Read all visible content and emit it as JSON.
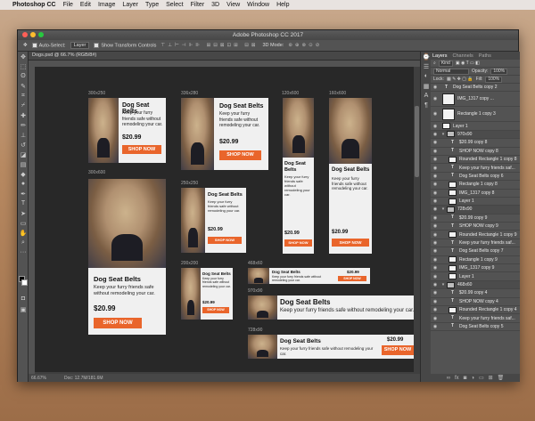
{
  "menubar": {
    "apple": "",
    "app": "Photoshop CC",
    "items": [
      "File",
      "Edit",
      "Image",
      "Layer",
      "Type",
      "Select",
      "Filter",
      "3D",
      "View",
      "Window",
      "Help"
    ]
  },
  "window": {
    "title": "Adobe Photoshop CC 2017"
  },
  "options": {
    "auto_select": "Auto-Select:",
    "layer_select": "Layer",
    "show_transform": "Show Transform Controls",
    "mode_3d": "3D Mode:"
  },
  "document": {
    "tab": "Dogs.psd @ 66.7% (RGB/8#)",
    "zoom": "66.67%",
    "doc_info": "Doc: 12.7M/181.6M"
  },
  "ad_copy": {
    "headline": "Dog Seat Belts",
    "body": "Keep your furry friends safe without remodeling your car.",
    "price": "$20.99",
    "button": "SHOP NOW"
  },
  "ads": [
    {
      "label": "300x250"
    },
    {
      "label": "336x280"
    },
    {
      "label": "120x600"
    },
    {
      "label": "160x600"
    },
    {
      "label": "300x600"
    },
    {
      "label": "250x250"
    },
    {
      "label": "200x200"
    },
    {
      "label": "468x60"
    },
    {
      "label": "970x90"
    },
    {
      "label": "728x90"
    }
  ],
  "layers_panel": {
    "tabs": [
      "Layers",
      "Channels",
      "Paths"
    ],
    "filter": "Kind",
    "blend": "Normal",
    "opacity_label": "Opacity:",
    "opacity": "100%",
    "lock_label": "Lock:",
    "fill_label": "Fill:",
    "fill": "100%",
    "layers": [
      {
        "name": "Dog Seat Belts copy 2",
        "kind": "T"
      },
      {
        "name": "IMG_1317 copy ...",
        "kind": "img"
      },
      {
        "name": "Rectangle 1 copy 3",
        "kind": "img"
      },
      {
        "name": "Layer 1",
        "kind": "img"
      },
      {
        "name": "970x90",
        "kind": "group"
      },
      {
        "name": "$20.99 copy 8",
        "kind": "T"
      },
      {
        "name": "SHOP NOW copy 8",
        "kind": "T"
      },
      {
        "name": "Rounded Rectangle 1 copy 8",
        "kind": "img"
      },
      {
        "name": "Keep your furry friends saf...",
        "kind": "T"
      },
      {
        "name": "Dog Seat Belts copy 6",
        "kind": "T"
      },
      {
        "name": "Rectangle 1 copy 8",
        "kind": "img"
      },
      {
        "name": "IMG_1317 copy 8",
        "kind": "img"
      },
      {
        "name": "Layer 1",
        "kind": "img"
      },
      {
        "name": "728x90",
        "kind": "group"
      },
      {
        "name": "$20.99 copy 9",
        "kind": "T"
      },
      {
        "name": "SHOP NOW copy 9",
        "kind": "T"
      },
      {
        "name": "Rounded Rectangle 1 copy 9",
        "kind": "img"
      },
      {
        "name": "Keep your furry friends saf...",
        "kind": "T"
      },
      {
        "name": "Dog Seat Belts copy 7",
        "kind": "T"
      },
      {
        "name": "Rectangle 1 copy 9",
        "kind": "img"
      },
      {
        "name": "IMG_1317 copy 9",
        "kind": "img"
      },
      {
        "name": "Layer 1",
        "kind": "img"
      },
      {
        "name": "468x60",
        "kind": "group"
      },
      {
        "name": "$20.99 copy 4",
        "kind": "T"
      },
      {
        "name": "SHOP NOW copy 4",
        "kind": "T"
      },
      {
        "name": "Rounded Rectangle 1 copy 4",
        "kind": "img"
      },
      {
        "name": "Keep your furry friends saf...",
        "kind": "T"
      },
      {
        "name": "Dog Seat Belts copy 5",
        "kind": "T"
      }
    ]
  },
  "colors": {
    "accent": "#e9652b",
    "canvas": "#282828",
    "panel": "#535353"
  }
}
